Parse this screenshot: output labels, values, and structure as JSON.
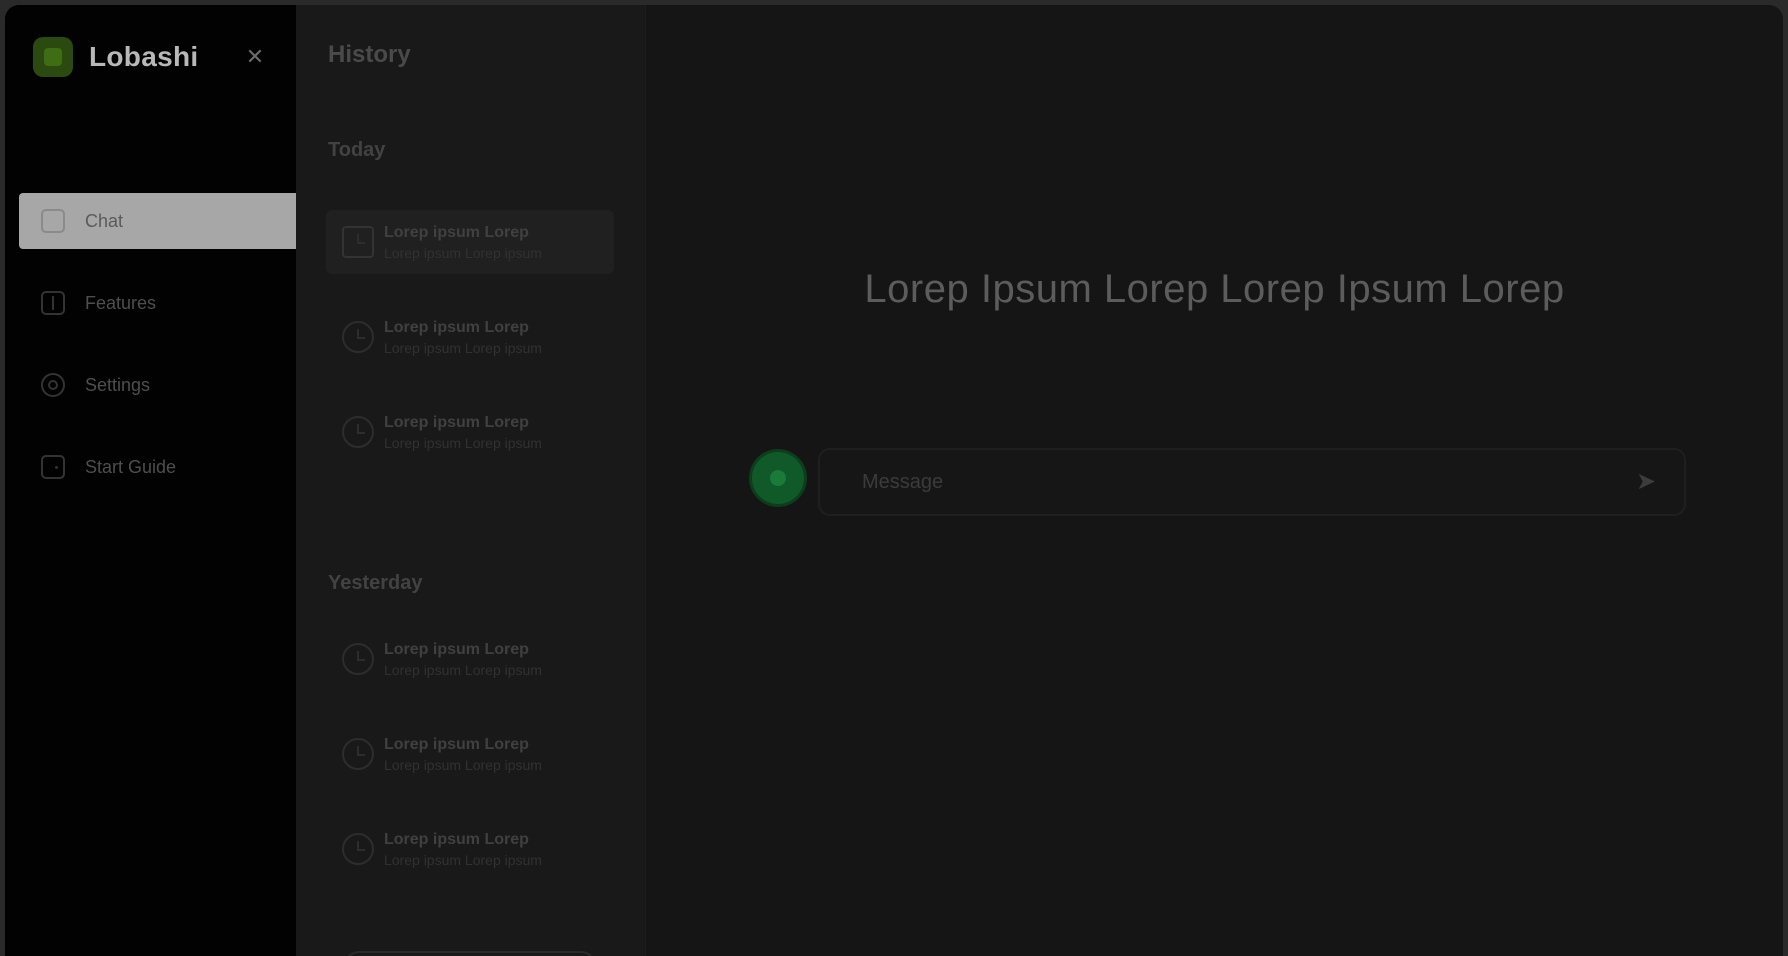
{
  "app": {
    "name": "Lobashi",
    "collapse_icon": "close-icon"
  },
  "nav": {
    "items": [
      {
        "label": "Chat",
        "icon": "chat-icon",
        "active": true
      },
      {
        "label": "Features",
        "icon": "grid-icon",
        "active": false
      },
      {
        "label": "Settings",
        "icon": "gear-icon",
        "active": false
      },
      {
        "label": "Start Guide",
        "icon": "door-icon",
        "active": false
      }
    ]
  },
  "history": {
    "title": "History",
    "groups": [
      {
        "label": "Today",
        "items": [
          {
            "title": "Lorep ipsum Lorep",
            "subtitle": "Lorep ipsum Lorep ipsum"
          },
          {
            "title": "Lorep ipsum Lorep",
            "subtitle": "Lorep ipsum Lorep ipsum"
          },
          {
            "title": "Lorep ipsum Lorep",
            "subtitle": "Lorep ipsum Lorep ipsum"
          }
        ]
      },
      {
        "label": "Yesterday",
        "items": [
          {
            "title": "Lorep ipsum Lorep",
            "subtitle": "Lorep ipsum Lorep ipsum"
          },
          {
            "title": "Lorep ipsum Lorep",
            "subtitle": "Lorep ipsum Lorep ipsum"
          },
          {
            "title": "Lorep ipsum Lorep",
            "subtitle": "Lorep ipsum Lorep ipsum"
          }
        ]
      }
    ]
  },
  "main": {
    "headline": "Lorep Ipsum Lorep Lorep Ipsum Lorep",
    "composer": {
      "placeholder": "Message",
      "send_icon": "send-icon"
    }
  },
  "colors": {
    "accent_green": "#0f5a28",
    "brand_green": "#2b4a10",
    "active_nav": "#a7a7a7"
  }
}
